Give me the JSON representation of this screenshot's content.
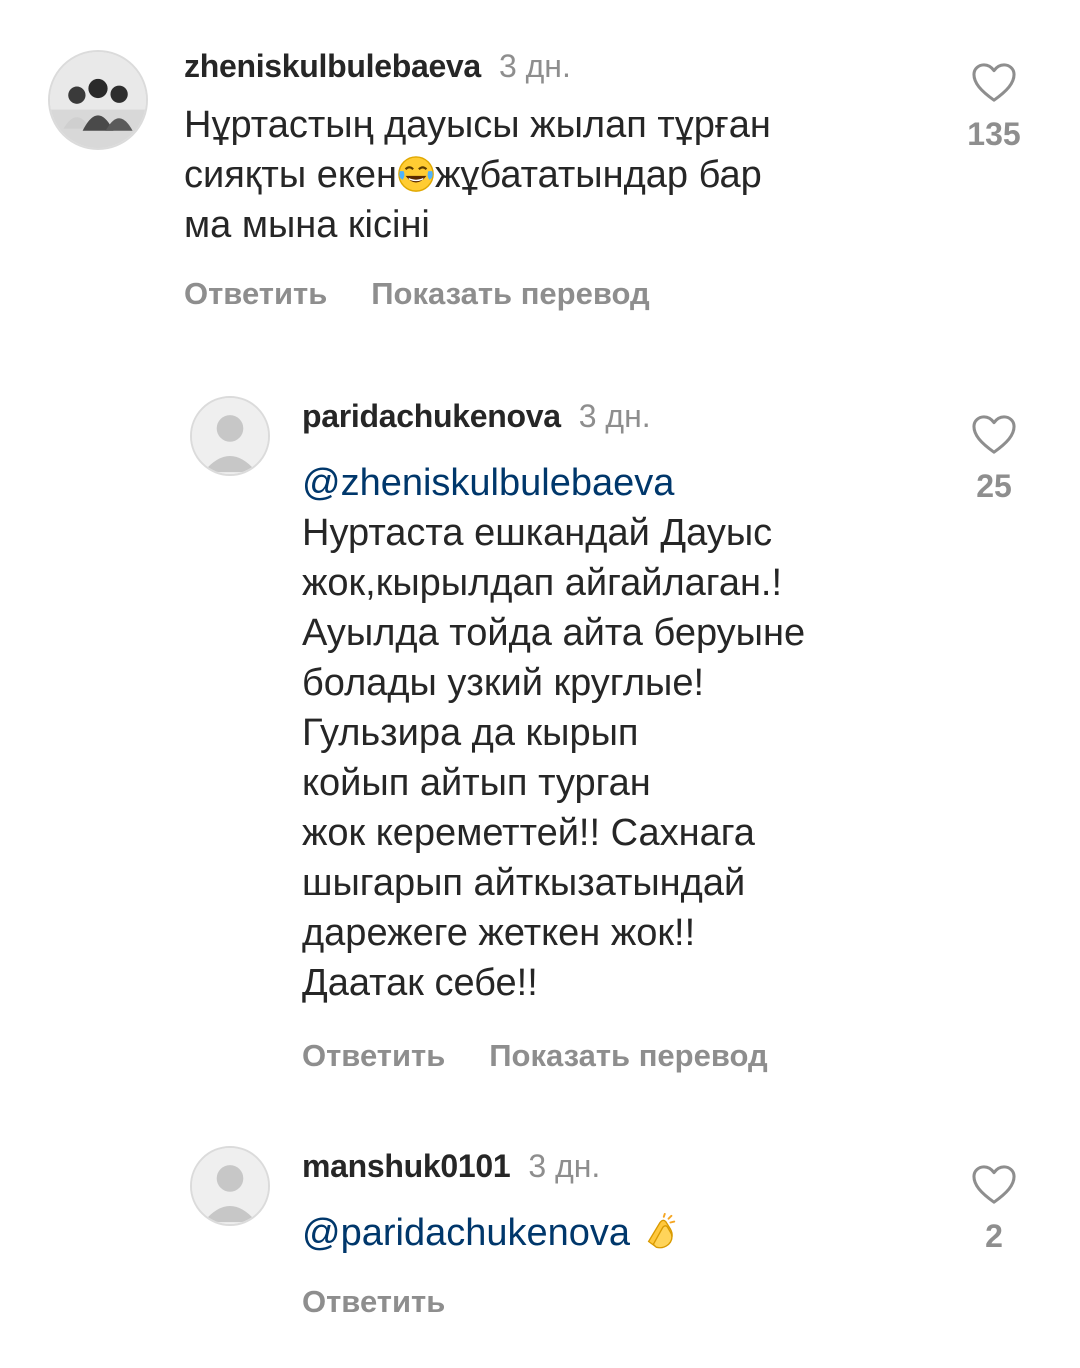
{
  "comments": [
    {
      "username": "zheniskulbulebaeva",
      "time": "3 дн.",
      "lines": [
        "Нұртастың дауысы жылап тұрған",
        "сияқты екен",
        "жұбататындар бар",
        "ма мына кісіні"
      ],
      "emoji": "tears-of-joy-emoji",
      "likes": "135",
      "reply_label": "Ответить",
      "translate_label": "Показать перевод"
    },
    {
      "username": "paridachukenova",
      "time": "3 дн.",
      "mention": "@zheniskulbulebaeva",
      "lines": [
        "Нуртаста  ешкандай  Дауыс",
        "жок,кырылдап айгайлаган.!",
        "Ауылда  тойда  айта  беруыне",
        "болады  узкий  круглые!",
        "Гульзира  да  кырып",
        "койып  айтып  турган",
        "жок  кереметтей!! Сахнага",
        "шыгарып  айткызатындай",
        "дарежеге  жеткен  жок!!",
        "Даатак  себе!!"
      ],
      "likes": "25",
      "reply_label": "Ответить",
      "translate_label": "Показать перевод"
    },
    {
      "username": "manshuk0101",
      "time": "3 дн.",
      "mention": "@paridachukenova",
      "emoji": "clapping-hands-emoji",
      "likes": "2",
      "reply_label": "Ответить"
    }
  ]
}
